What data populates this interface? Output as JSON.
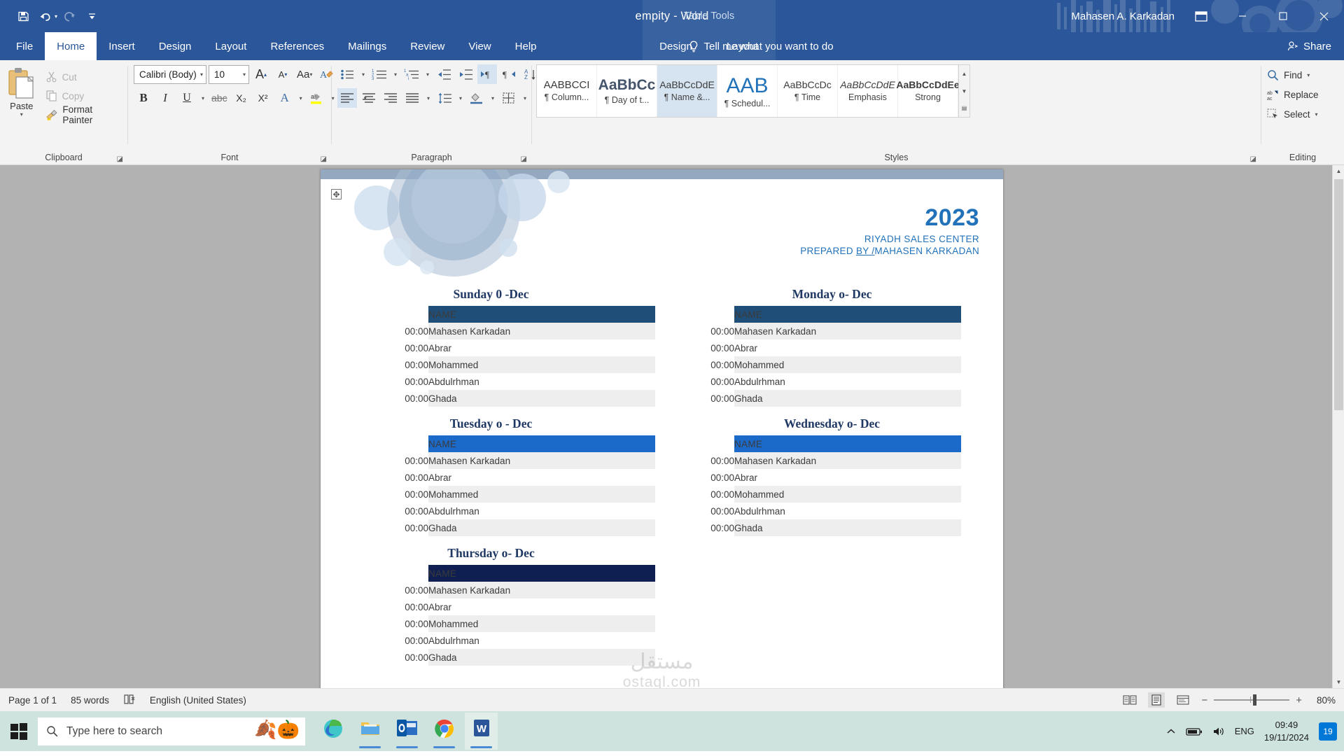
{
  "window": {
    "document_title": "empity  -  Word",
    "contextual_tab_group": "Table Tools",
    "user_name": "Mahasen A. Karkadan",
    "quick_access": [
      "save-icon",
      "undo-icon",
      "redo-icon",
      "customize-qat-icon"
    ],
    "controls": {
      "minimize": "−",
      "restore": "❐",
      "close": "✕",
      "ribbon_display": "❐"
    }
  },
  "tabs": {
    "items": [
      {
        "label": "File",
        "active": false
      },
      {
        "label": "Home",
        "active": true
      },
      {
        "label": "Insert",
        "active": false
      },
      {
        "label": "Design",
        "active": false
      },
      {
        "label": "Layout",
        "active": false
      },
      {
        "label": "References",
        "active": false
      },
      {
        "label": "Mailings",
        "active": false
      },
      {
        "label": "Review",
        "active": false
      },
      {
        "label": "View",
        "active": false
      },
      {
        "label": "Help",
        "active": false
      }
    ],
    "contextual": [
      {
        "label": "Design"
      },
      {
        "label": "Layout"
      }
    ],
    "tell_me": "Tell me what you want to do",
    "share": "Share"
  },
  "ribbon": {
    "clipboard": {
      "group_label": "Clipboard",
      "paste_label": "Paste",
      "cut_label": "Cut",
      "copy_label": "Copy",
      "format_painter_label": "Format Painter"
    },
    "font": {
      "group_label": "Font",
      "font_name": "Calibri (Body)",
      "font_size": "10",
      "buttons": [
        "grow-font-icon",
        "shrink-font-icon",
        "change-case-icon",
        "clear-formatting-icon",
        "bold-icon",
        "italic-icon",
        "underline-icon",
        "strikethrough-icon",
        "subscript-icon",
        "superscript-icon",
        "text-effects-icon",
        "text-highlight-icon",
        "font-color-icon"
      ],
      "bold_label": "B",
      "italic_label": "I",
      "underline_label": "U",
      "strikethrough_label": "abc",
      "subscript_label": "X₂",
      "superscript_label": "X²",
      "change_case_label": "Aa",
      "grow_label": "A",
      "shrink_label": "A"
    },
    "paragraph": {
      "group_label": "Paragraph",
      "buttons": [
        "bullets-icon",
        "numbering-icon",
        "multilevel-list-icon",
        "decrease-indent-icon",
        "increase-indent-icon",
        "ltr-text-direction-icon",
        "rtl-text-direction-icon",
        "sort-icon",
        "show-formatting-marks-icon",
        "align-left-icon",
        "align-center-icon",
        "align-right-icon",
        "justify-icon",
        "line-spacing-icon",
        "shading-icon",
        "borders-icon"
      ]
    },
    "styles": {
      "group_label": "Styles",
      "items": [
        {
          "preview": "AABBCCI",
          "name": "¶ Column...",
          "selected": false
        },
        {
          "preview": "AaBbCc",
          "name": "¶ Day of t...",
          "selected": false
        },
        {
          "preview": "AaBbCcDdE",
          "name": "¶ Name &...",
          "selected": true
        },
        {
          "preview": "AAB",
          "name": "¶ Schedul...",
          "selected": false
        },
        {
          "preview": "AaBbCcDc",
          "name": "¶ Time",
          "selected": false
        },
        {
          "preview": "AaBbCcDdE",
          "name": "Emphasis",
          "selected": false
        },
        {
          "preview": "AaBbCcDdEe",
          "name": "Strong",
          "selected": false
        }
      ]
    },
    "editing": {
      "group_label": "Editing",
      "find_label": "Find",
      "replace_label": "Replace",
      "select_label": "Select"
    }
  },
  "document": {
    "header": {
      "year": "2023",
      "center": "RIYADH SALES CENTER",
      "prepared_prefix": "PREPARED ",
      "prepared_by": "BY /",
      "prepared_name": "MAHASEN  KARKADAN"
    },
    "name_column_header": "NAME",
    "days": [
      {
        "title": "Sunday  0 -Dec",
        "header_color": "#1f4e79",
        "rows": [
          {
            "time": "00:00",
            "name": "Mahasen Karkadan"
          },
          {
            "time": "00:00",
            "name": "Abrar"
          },
          {
            "time": "00:00",
            "name": "Mohammed"
          },
          {
            "time": "00:00",
            "name": "Abdulrhman"
          },
          {
            "time": "00:00",
            "name": "Ghada"
          }
        ]
      },
      {
        "title": "Monday  o- Dec",
        "header_color": "#1f4e79",
        "rows": [
          {
            "time": "00:00",
            "name": "Mahasen Karkadan"
          },
          {
            "time": "00:00",
            "name": "Abrar"
          },
          {
            "time": "00:00",
            "name": "Mohammed"
          },
          {
            "time": "00:00",
            "name": "Abdulrhman"
          },
          {
            "time": "00:00",
            "name": "Ghada"
          }
        ]
      },
      {
        "title": "Tuesday  o - Dec",
        "header_color": "#1b6ac9",
        "rows": [
          {
            "time": "00:00",
            "name": "Mahasen Karkadan"
          },
          {
            "time": "00:00",
            "name": "Abrar"
          },
          {
            "time": "00:00",
            "name": "Mohammed"
          },
          {
            "time": "00:00",
            "name": "Abdulrhman"
          },
          {
            "time": "00:00",
            "name": "Ghada"
          }
        ]
      },
      {
        "title": "Wednesday  o- Dec",
        "header_color": "#1b6ac9",
        "rows": [
          {
            "time": "00:00",
            "name": "Mahasen Karkadan"
          },
          {
            "time": "00:00",
            "name": "Abrar"
          },
          {
            "time": "00:00",
            "name": "Mohammed"
          },
          {
            "time": "00:00",
            "name": "Abdulrhman"
          },
          {
            "time": "00:00",
            "name": "Ghada"
          }
        ]
      },
      {
        "title": "Thursday  o- Dec",
        "header_color": "#0f1f52",
        "rows": [
          {
            "time": "00:00",
            "name": "Mahasen Karkadan"
          },
          {
            "time": "00:00",
            "name": "Abrar"
          },
          {
            "time": "00:00",
            "name": "Mohammed"
          },
          {
            "time": "00:00",
            "name": "Abdulrhman"
          },
          {
            "time": "00:00",
            "name": "Ghada"
          }
        ]
      }
    ],
    "watermark_arabic": "مستقل",
    "watermark_latin": "ostaql.com"
  },
  "status_bar": {
    "page_info": "Page 1 of 1",
    "word_count": "85 words",
    "proofing_icon": "proofing-errors-icon",
    "language": "English (United States)",
    "views": [
      "read-mode-icon",
      "print-layout-icon",
      "web-layout-icon"
    ],
    "zoom_out": "−",
    "zoom_in": "+",
    "zoom_level": "80%"
  },
  "taskbar": {
    "start_icon": "windows-start-icon",
    "search_placeholder": "Type here to search",
    "search_decoration": "🍂🎃",
    "apps": [
      {
        "name": "microsoft-edge",
        "running": false
      },
      {
        "name": "file-explorer",
        "running": true
      },
      {
        "name": "outlook",
        "running": true
      },
      {
        "name": "google-chrome",
        "running": true
      },
      {
        "name": "microsoft-word",
        "running": true
      }
    ],
    "tray": {
      "show_hidden": "chevron-up-icon",
      "battery": "battery-icon",
      "volume": "volume-icon",
      "language": "ENG",
      "time": "09:49",
      "date": "19/11/2024",
      "notifications": "19"
    }
  },
  "colors": {
    "word_blue": "#2b579a",
    "accent_blue": "#2272b9",
    "table_header_dark": "#1f4e79",
    "table_header_bright": "#1b6ac9",
    "table_header_navy": "#0f1f52",
    "taskbar_bg": "#cfe3de"
  }
}
